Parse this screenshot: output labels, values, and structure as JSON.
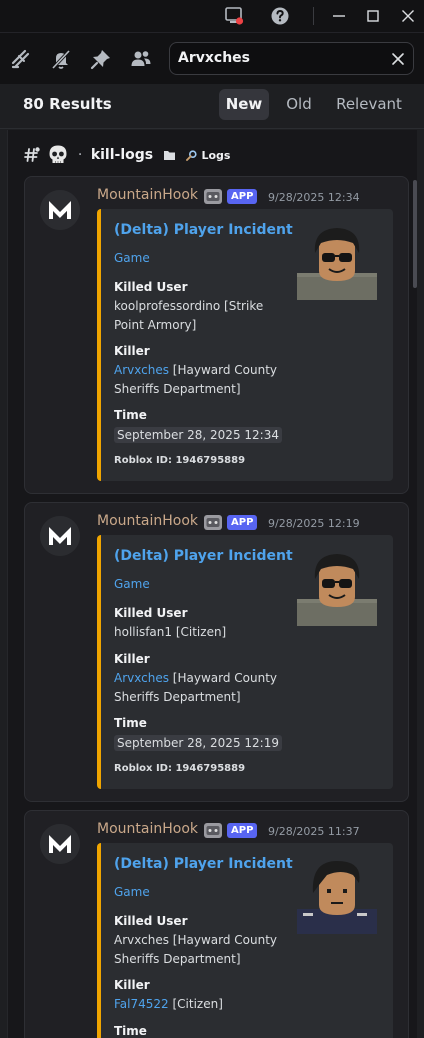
{
  "search": {
    "query": "Arvxches"
  },
  "results": {
    "count_label": "80 Results",
    "sort_tabs": [
      "New",
      "Old",
      "Relevant"
    ],
    "active_sort": "New"
  },
  "channel": {
    "name": "kill-logs",
    "separator": "·",
    "category": "Logs"
  },
  "colors": {
    "accent_link": "#4fa3ec",
    "embed_border": "#f0a500",
    "app_badge": "#5865f2",
    "author": "#c9a88a"
  },
  "messages": [
    {
      "author": "MountainHook",
      "badge": "APP",
      "timestamp": "9/28/2025 12:34",
      "embed": {
        "title": "(Delta) Player Incident",
        "subtitle": "Game",
        "killed_label": "Killed User",
        "killed_value": "koolprofessordino [Strike Point Armory]",
        "killer_label": "Killer",
        "killer_link": "Arvxches",
        "killer_rest": " [Hayward County Sheriffs Department]",
        "time_label": "Time",
        "time_value": "September 28, 2025 12:34",
        "footer": "Roblox ID: 1946795889"
      }
    },
    {
      "author": "MountainHook",
      "badge": "APP",
      "timestamp": "9/28/2025 12:19",
      "embed": {
        "title": "(Delta) Player Incident",
        "subtitle": "Game",
        "killed_label": "Killed User",
        "killed_value": "hollisfan1 [Citizen]",
        "killer_label": "Killer",
        "killer_link": "Arvxches",
        "killer_rest": " [Hayward County Sheriffs Department]",
        "time_label": "Time",
        "time_value": "September 28, 2025 12:19",
        "footer": "Roblox ID: 1946795889"
      }
    },
    {
      "author": "MountainHook",
      "badge": "APP",
      "timestamp": "9/28/2025 11:37",
      "embed": {
        "title": "(Delta) Player Incident",
        "subtitle": "Game",
        "killed_label": "Killed User",
        "killed_value": "Arvxches [Hayward County Sheriffs Department]",
        "killer_label": "Killer",
        "killer_link": "Fal74522",
        "killer_rest": " [Citizen]",
        "time_label": "Time"
      }
    }
  ]
}
